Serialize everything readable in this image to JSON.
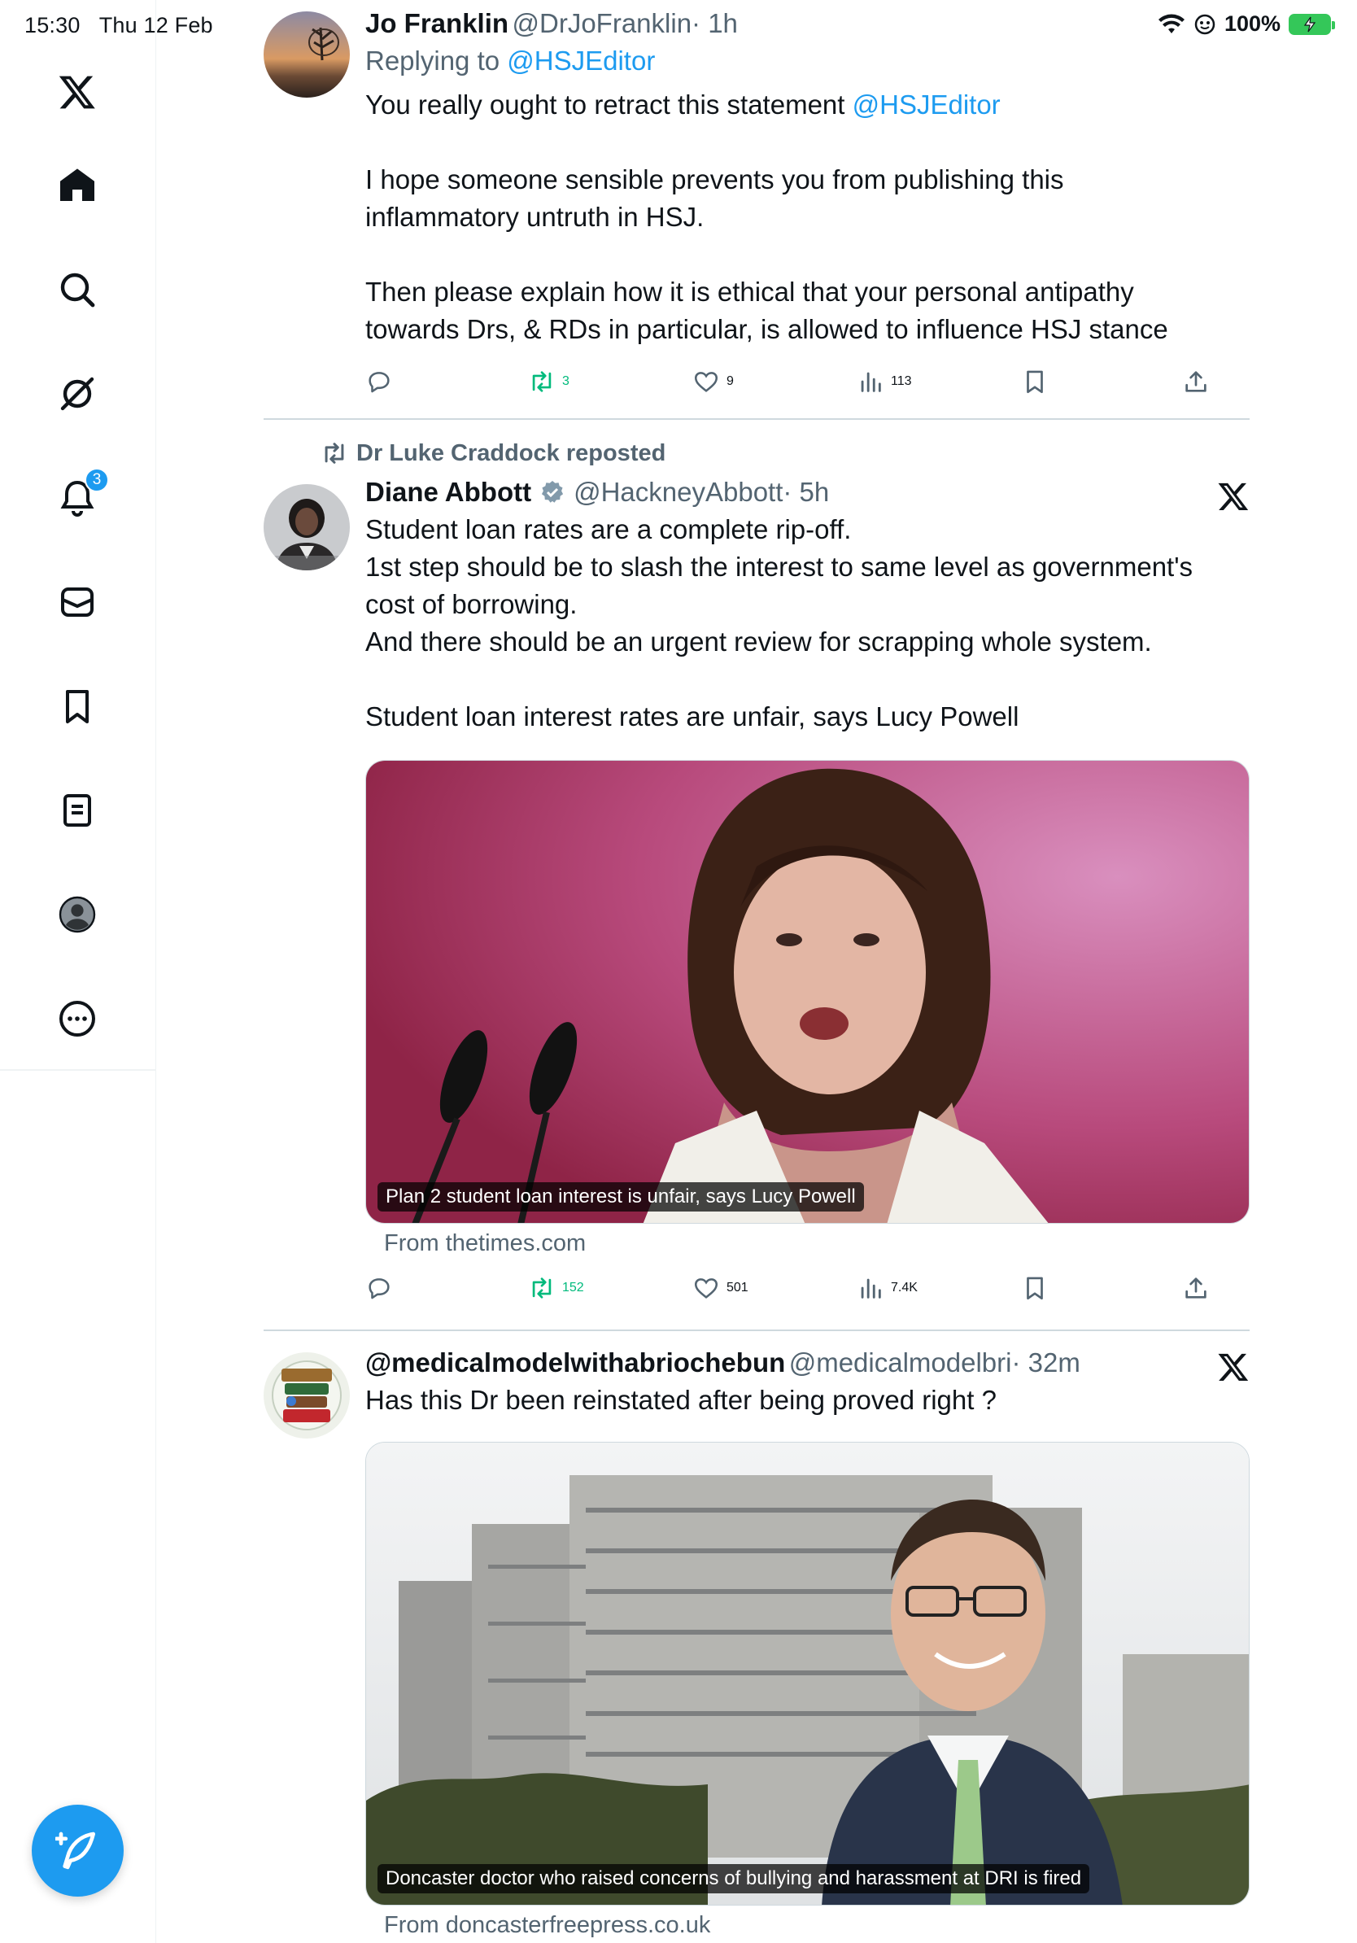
{
  "status_bar": {
    "time": "15:30",
    "date": "Thu 12 Feb",
    "battery": "100%"
  },
  "sidebar": {
    "items": [
      {
        "name": "x-logo"
      },
      {
        "name": "home"
      },
      {
        "name": "search"
      },
      {
        "name": "grok"
      },
      {
        "name": "notifications",
        "badge": "3"
      },
      {
        "name": "messages"
      },
      {
        "name": "bookmarks"
      },
      {
        "name": "lists"
      },
      {
        "name": "profile"
      },
      {
        "name": "more"
      }
    ],
    "compose_label": "Compose post"
  },
  "tweets": [
    {
      "name": "Jo Franklin",
      "handle": "@DrJoFranklin",
      "time": "· 1h",
      "replying_prefix": "Replying to ",
      "replying_to": "@HSJEditor",
      "text_line1_a": "You really ought to retract this statement ",
      "text_line1_mention": "@HSJEditor",
      "text_p2": "I hope someone sensible prevents you from publishing this inflammatory untruth in HSJ.",
      "text_p3": "Then please explain how it is ethical that your personal antipathy towards Drs, & RDs in particular, is allowed to influence HSJ stance",
      "retweets": "3",
      "likes": "9",
      "views": "113"
    },
    {
      "reposted_by": "Dr Luke Craddock reposted",
      "name": "Diane Abbott",
      "handle": "@HackneyAbbott",
      "time": "· 5h",
      "text_p1": "Student loan rates are a complete rip-off.\n1st step should be to slash the interest to same level as government's cost of borrowing.\nAnd there should be an urgent review for scrapping whole system.",
      "text_p2": "Student loan interest rates are unfair, says Lucy Powell",
      "card_caption": "Plan 2 student loan interest is unfair, says Lucy Powell",
      "card_source": "From thetimes.com",
      "retweets": "152",
      "likes": "501",
      "views": "7.4K"
    },
    {
      "name": "@medicalmodelwithabriochebun",
      "handle": "@medicalmodelbri",
      "time": "· 32m",
      "text_p1": "Has this Dr been reinstated after being proved right ?",
      "card_caption": "Doncaster doctor who raised concerns of bullying and harassment at DRI is fired",
      "card_source": "From doncasterfreepress.co.uk"
    }
  ],
  "colors": {
    "accent": "#1d9bf0",
    "retweet": "#00ba7c",
    "secondary_text": "#536471"
  }
}
